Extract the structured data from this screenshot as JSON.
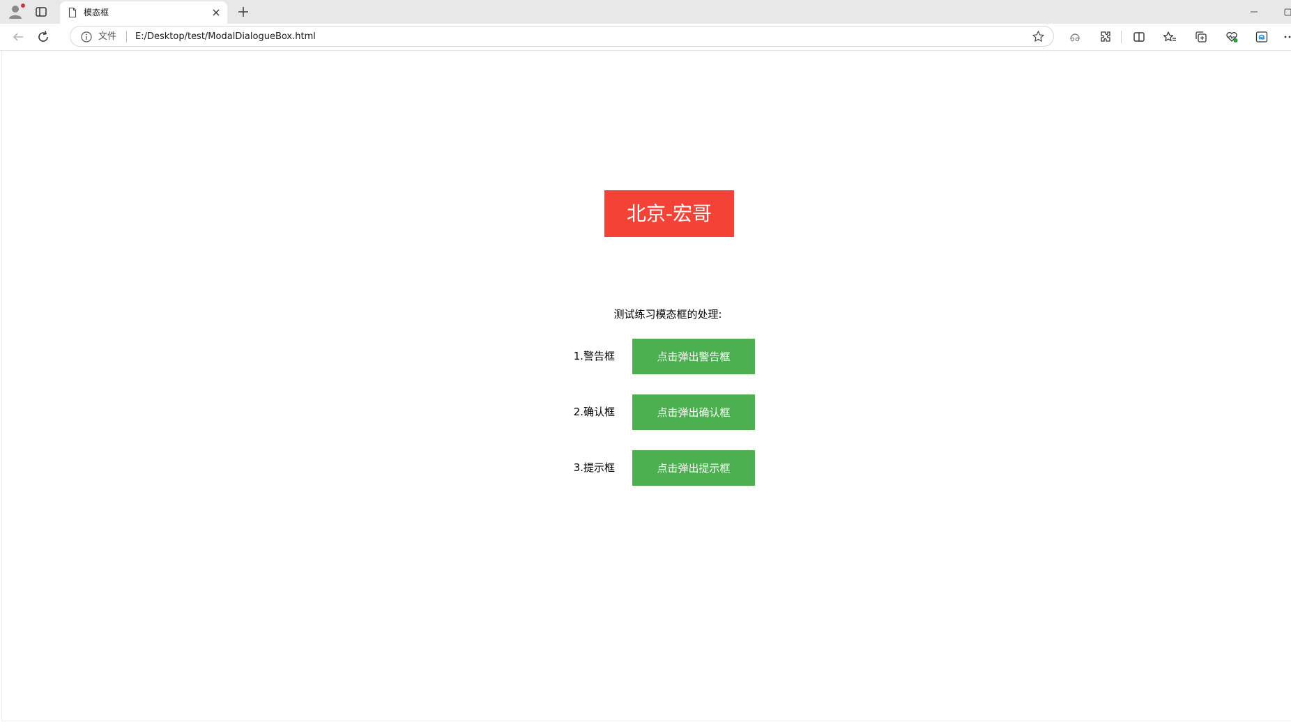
{
  "browser": {
    "tab": {
      "title": "模态框"
    },
    "address": {
      "scheme_label": "文件",
      "url": "E:/Desktop/test/ModalDialogueBox.html"
    },
    "icons": {
      "profile": "profile-avatar-icon",
      "tab_actions": "tab-actions-icon",
      "favicon": "document-icon",
      "close_tab": "close-icon",
      "new_tab": "plus-icon",
      "back": "arrow-left-icon",
      "refresh": "refresh-icon",
      "site_info": "info-icon",
      "favorite": "star-icon",
      "read_aloud": "read-aloud-icon",
      "extensions": "puzzle-icon",
      "split_screen": "split-screen-icon",
      "favorites_bar": "favorites-icon",
      "collections": "collections-icon",
      "browser_essentials": "heart-pulse-icon",
      "edge_sidebar": "edge-icon",
      "more": "ellipsis-icon"
    }
  },
  "page": {
    "banner": "北京-宏哥",
    "intro": "测试练习模态框的处理:",
    "rows": [
      {
        "label": "1.警告框",
        "button": "点击弹出警告框"
      },
      {
        "label": "2.确认框",
        "button": "点击弹出确认框"
      },
      {
        "label": "3.提示框",
        "button": "点击弹出提示框"
      }
    ]
  },
  "colors": {
    "banner_bg": "#f44336",
    "button_bg": "#4caf50",
    "button_text": "#ffffff"
  }
}
